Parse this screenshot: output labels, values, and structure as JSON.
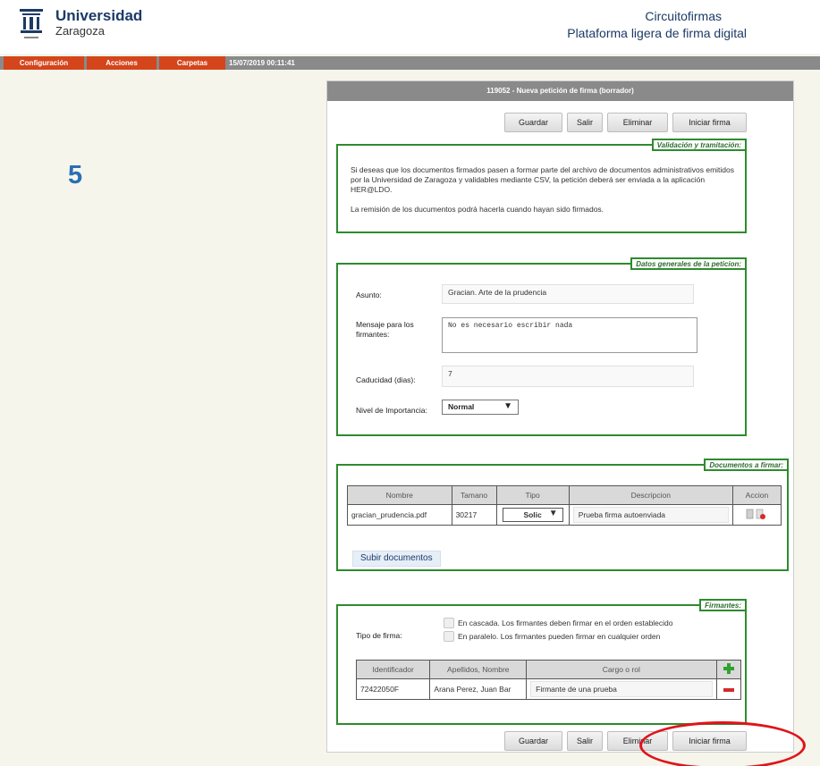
{
  "header": {
    "university_name": "Universidad",
    "university_city": "Zaragoza",
    "app_title": "Circuitofirmas",
    "app_subtitle": "Plataforma ligera de firma digital"
  },
  "nav": {
    "items": [
      "Configuración",
      "Acciones",
      "Carpetas"
    ],
    "datetime": "15/07/2019 00:11:41"
  },
  "step_number": "5",
  "panel": {
    "title": "119052 - Nueva petición de firma (borrador)",
    "buttons": {
      "save": "Guardar",
      "exit": "Salir",
      "delete": "Eliminar",
      "start": "Iniciar firma"
    }
  },
  "validation": {
    "legend": "Validación y tramitación:",
    "paragraph1": "Si deseas que los documentos firmados pasen a formar parte del archivo de documentos administrativos emitidos por la Universidad de Zaragoza y validables mediante CSV, la petición deberá ser enviada a la aplicación HER@LDO.",
    "paragraph2": "La remisión de los ducumentos podrá hacerla cuando hayan sido firmados."
  },
  "general": {
    "legend": "Datos generales de la peticion:",
    "subject_label": "Asunto:",
    "subject_value": "Gracian. Arte de la prudencia",
    "message_label": "Mensaje para los firmantes:",
    "message_value": "No es necesario escribir nada",
    "expiry_label": "Caducidad (dias):",
    "expiry_value": "7",
    "priority_label": "Nivel de Importancia:",
    "priority_value": "Normal"
  },
  "documents": {
    "legend": "Documentos a firmar:",
    "columns": [
      "Nombre",
      "Tamano",
      "Tipo",
      "Descripcion",
      "Accion"
    ],
    "rows": [
      {
        "name": "gracian_prudencia.pdf",
        "size": "30217",
        "type": "Solic",
        "description": "Prueba firma autoenviada"
      }
    ],
    "upload_label": "Subir documentos"
  },
  "signers": {
    "legend": "Firmantes:",
    "type_label": "Tipo de firma:",
    "option_cascade": "En cascada. Los firmantes deben firmar en el orden establecido",
    "option_parallel": "En paralelo. Los firmantes pueden firmar en cualquier orden",
    "columns": [
      "Identificador",
      "Apellidos, Nombre",
      "Cargo o rol"
    ],
    "rows": [
      {
        "id": "72422050F",
        "name": "Arana Perez, Juan Bar",
        "role": "Firmante de una prueba"
      }
    ]
  },
  "colors": {
    "accent_orange": "#d4451b",
    "fieldset_green": "#2e8b2e",
    "highlight_red": "#e0141b",
    "brand_blue": "#1c3a66"
  }
}
